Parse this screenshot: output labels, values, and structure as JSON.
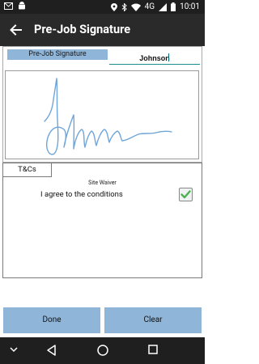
{
  "status_bar": {
    "time": "10:01",
    "network": "4G",
    "icons": [
      "mail-icon",
      "android-icon",
      "location-icon",
      "bluetooth-icon",
      "wifi-icon",
      "signal-icon",
      "battery-icon"
    ]
  },
  "app_bar": {
    "title": "Pre-Job Signature",
    "back_icon": "arrow-left-icon"
  },
  "signature": {
    "label": "Pre-Job Signature",
    "name_value": "Johnson",
    "stroke_color": "#6fa5d8"
  },
  "tabs": [
    {
      "label": "T&Cs"
    }
  ],
  "terms": {
    "heading": "Site Waiver",
    "agree_text": "I agree to the conditions",
    "checked": true,
    "check_color": "#4cb050"
  },
  "buttons": {
    "done": "Done",
    "clear": "Clear",
    "color": "#8fb5d8"
  },
  "nav_bar": {
    "icons": [
      "chevron-down-icon",
      "back-triangle-icon",
      "home-circle-icon",
      "recents-square-icon"
    ]
  }
}
